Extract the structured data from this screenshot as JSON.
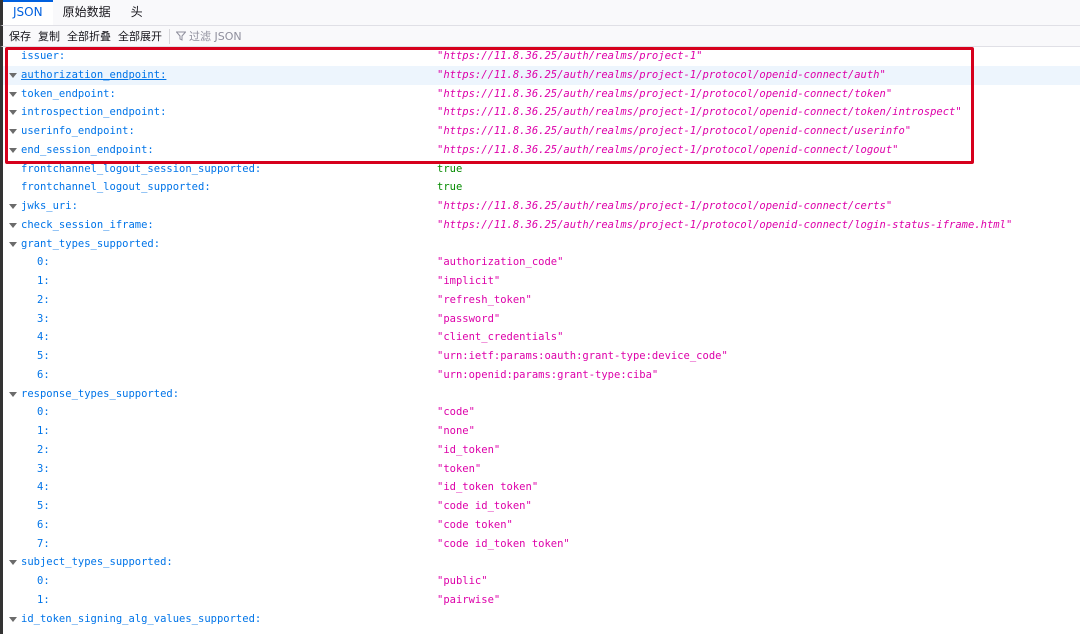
{
  "tabs": [
    {
      "label": "JSON",
      "active": true
    },
    {
      "label": "原始数据"
    },
    {
      "label": "头"
    }
  ],
  "toolbar": {
    "save": "保存",
    "copy": "复制",
    "collapse_all": "全部折叠",
    "expand_all": "全部展开",
    "filter_placeholder": "过滤 JSON"
  },
  "colors": {
    "highlight_box": "#d6001c",
    "key": "#0074e8",
    "string": "#dd00a9",
    "bool": "#058b00"
  },
  "rows": [
    {
      "key": "issuer:",
      "value": "\"https://11.8.36.25/auth/realms/project-1\"",
      "type": "url"
    },
    {
      "key": "authorization_endpoint:",
      "value": "\"https://11.8.36.25/auth/realms/project-1/protocol/openid-connect/auth\"",
      "type": "url",
      "toggle": true,
      "hover": true
    },
    {
      "key": "token_endpoint:",
      "value": "\"https://11.8.36.25/auth/realms/project-1/protocol/openid-connect/token\"",
      "type": "url",
      "toggle": true
    },
    {
      "key": "introspection_endpoint:",
      "value": "\"https://11.8.36.25/auth/realms/project-1/protocol/openid-connect/token/introspect\"",
      "type": "url",
      "toggle": true
    },
    {
      "key": "userinfo_endpoint:",
      "value": "\"https://11.8.36.25/auth/realms/project-1/protocol/openid-connect/userinfo\"",
      "type": "url",
      "toggle": true
    },
    {
      "key": "end_session_endpoint:",
      "value": "\"https://11.8.36.25/auth/realms/project-1/protocol/openid-connect/logout\"",
      "type": "url",
      "toggle": true
    },
    {
      "key": "frontchannel_logout_session_supported:",
      "value": "true",
      "type": "bool"
    },
    {
      "key": "frontchannel_logout_supported:",
      "value": "true",
      "type": "bool"
    },
    {
      "key": "jwks_uri:",
      "value": "\"https://11.8.36.25/auth/realms/project-1/protocol/openid-connect/certs\"",
      "type": "url",
      "toggle": true
    },
    {
      "key": "check_session_iframe:",
      "value": "\"https://11.8.36.25/auth/realms/project-1/protocol/openid-connect/login-status-iframe.html\"",
      "type": "url",
      "toggle": true
    },
    {
      "key": "grant_types_supported:",
      "toggle": true
    },
    {
      "key": "0:",
      "value": "\"authorization_code\"",
      "type": "str",
      "idx": true
    },
    {
      "key": "1:",
      "value": "\"implicit\"",
      "type": "str",
      "idx": true
    },
    {
      "key": "2:",
      "value": "\"refresh_token\"",
      "type": "str",
      "idx": true
    },
    {
      "key": "3:",
      "value": "\"password\"",
      "type": "str",
      "idx": true
    },
    {
      "key": "4:",
      "value": "\"client_credentials\"",
      "type": "str",
      "idx": true
    },
    {
      "key": "5:",
      "value": "\"urn:ietf:params:oauth:grant-type:device_code\"",
      "type": "str",
      "idx": true
    },
    {
      "key": "6:",
      "value": "\"urn:openid:params:grant-type:ciba\"",
      "type": "str",
      "idx": true
    },
    {
      "key": "response_types_supported:",
      "toggle": true
    },
    {
      "key": "0:",
      "value": "\"code\"",
      "type": "str",
      "idx": true
    },
    {
      "key": "1:",
      "value": "\"none\"",
      "type": "str",
      "idx": true
    },
    {
      "key": "2:",
      "value": "\"id_token\"",
      "type": "str",
      "idx": true
    },
    {
      "key": "3:",
      "value": "\"token\"",
      "type": "str",
      "idx": true
    },
    {
      "key": "4:",
      "value": "\"id_token token\"",
      "type": "str",
      "idx": true
    },
    {
      "key": "5:",
      "value": "\"code id_token\"",
      "type": "str",
      "idx": true
    },
    {
      "key": "6:",
      "value": "\"code token\"",
      "type": "str",
      "idx": true
    },
    {
      "key": "7:",
      "value": "\"code id_token token\"",
      "type": "str",
      "idx": true
    },
    {
      "key": "subject_types_supported:",
      "toggle": true
    },
    {
      "key": "0:",
      "value": "\"public\"",
      "type": "str",
      "idx": true
    },
    {
      "key": "1:",
      "value": "\"pairwise\"",
      "type": "str",
      "idx": true
    },
    {
      "key": "id_token_signing_alg_values_supported:",
      "toggle": true
    }
  ]
}
